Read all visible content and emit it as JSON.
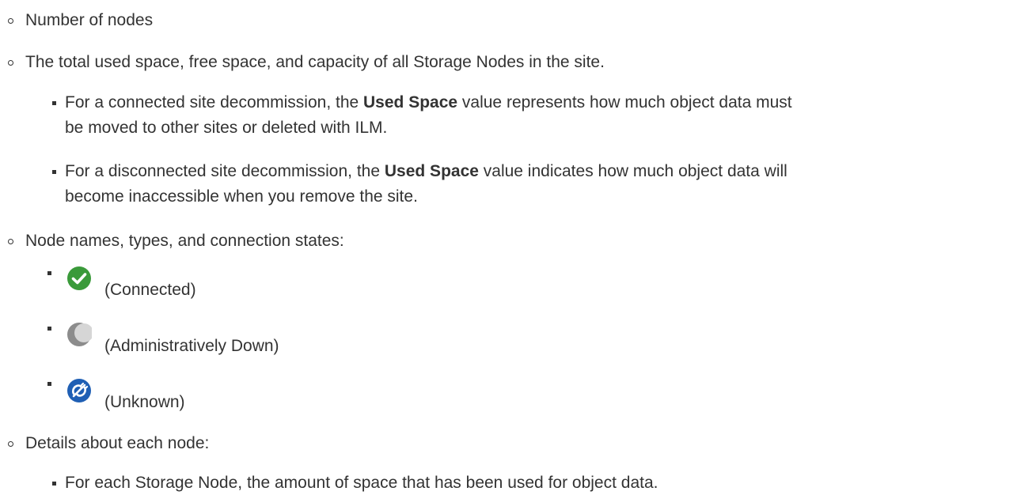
{
  "items": {
    "nodes_count": "Number of nodes",
    "space_summary": "The total used space, free space, and capacity of all Storage Nodes in the site.",
    "connected_decom": {
      "prefix": "For a connected site decommission, the ",
      "bold": "Used Space",
      "suffix_line1": " value represents how much object data must",
      "line2": "be moved to other sites or deleted with ILM."
    },
    "disconnected_decom": {
      "prefix": "For a disconnected site decommission, the ",
      "bold": "Used Space",
      "suffix_line1": " value indicates how much object data will",
      "line2": "become inaccessible when you remove the site."
    },
    "node_states_heading": "Node names, types, and connection states:",
    "states": [
      {
        "icon": "connected-icon",
        "label": "(Connected)",
        "color": "#3a9a3a"
      },
      {
        "icon": "administratively-down-icon",
        "label": "(Administratively Down)",
        "color": "#8c8c8c"
      },
      {
        "icon": "unknown-icon",
        "label": "(Unknown)",
        "color": "#1f5fb4"
      }
    ],
    "details_heading": "Details about each node:",
    "storage_node_detail": "For each Storage Node, the amount of space that has been used for object data."
  }
}
